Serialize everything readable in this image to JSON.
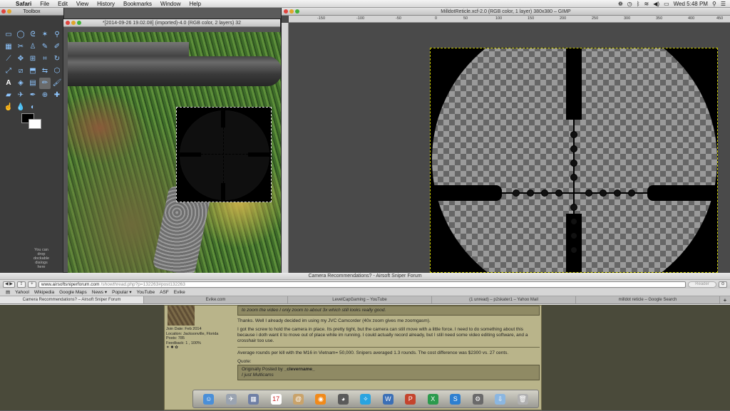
{
  "menubar": {
    "app": "Safari",
    "items": [
      "File",
      "Edit",
      "View",
      "History",
      "Bookmarks",
      "Window",
      "Help"
    ],
    "clock": "Wed 5:48 PM"
  },
  "toolbox": {
    "title": "Toolbox",
    "dock_hint": "You can drop dockable dialogs here"
  },
  "gimp1": {
    "title": "*[2014-09-26 19.02.08] (imported)-4.0 (RGB color, 2 layers) 32"
  },
  "gimp2": {
    "title": "MilldotReticle.xcf-2.0 (RGB color, 1 layer) 380x380 – GIMP",
    "ruler_ticks": [
      "-150",
      "-100",
      "-50",
      "0",
      "50",
      "100",
      "150",
      "200",
      "250",
      "300",
      "350",
      "400",
      "450"
    ]
  },
  "safari": {
    "title": "Camera Recommendations? - Airsoft Sniper Forum",
    "url_host": "www.airsoftsniperforum.com",
    "url_path": "/showthread.php?p=132263#post132263",
    "reader": "Reader",
    "bookmarks": [
      "Yahool",
      "Wikipedia",
      "Google Maps",
      "News ▾",
      "Popular ▾",
      "YouTube",
      "ASF",
      "Evike"
    ],
    "tabs": [
      "Camera Recommendations? – Airsoft Sniper Forum",
      "Evike.com",
      "LevelCapGaming – YouTube",
      "(1 unread) – p2skater1 – Yahoo Mail",
      "milldot reticle – Google Search"
    ]
  },
  "forum": {
    "join_date": "Join Date: Feb 2014",
    "location": "Location: Jacksonville, Florida",
    "posts": "Posts: 785",
    "feedback": "Feedback: 1 , 100%",
    "top_quote": "to zoom the video I only zoom to about 3x which still looks really good.",
    "p1": "Thanks. Well I already decided im using my JVC Camcorder (40x zoom gives me zoomgasm).",
    "p2": "I got the screw to hold the camera in place. Its pretty tight, but the camera can still move with a little force. I need to do something about this because i doth want it to move out of place while im running. I could actually record already, but I still need some video editing software, and a crosshair too use.",
    "p3": "Average rounds per kill with the M16 in Vietnam= 50,000. Snipers averaged 1.3 rounds. The cost difference was $2300 vs. 27 cents.",
    "quote_label": "Quote:",
    "quote_by_prefix": "Originally Posted by",
    "quote_author": "_clevername_",
    "quote_text": "I just Multicams"
  }
}
